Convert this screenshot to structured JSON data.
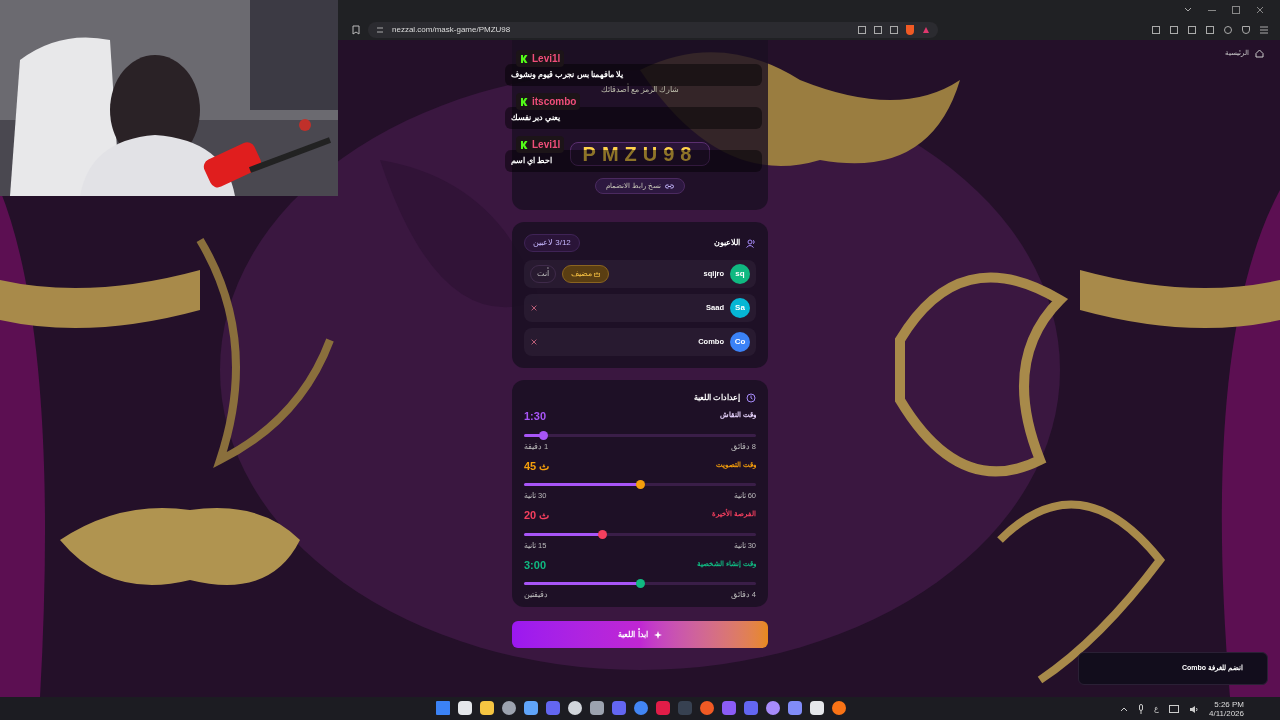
{
  "browser": {
    "url": "nezzal.com/mask-game/PMZU98"
  },
  "nav": {
    "home": "الرئيسية"
  },
  "room": {
    "share_hint": "شارك الرمز مع أصدقائك",
    "code": "PMZU98",
    "copy_link": "نسخ رابط الانضمام"
  },
  "chat_overlay": [
    {
      "user": "Levi1l",
      "message": "يلا مافهمنا بس نجرب قيوم ونشوف"
    },
    {
      "user": "itscombo",
      "message": "يعني دبر نفسك"
    },
    {
      "user": "Levi1l",
      "message": "احط اي اسم"
    }
  ],
  "players": {
    "title": "اللاعبون",
    "count": "3/12 لاعبين",
    "items": [
      {
        "name": "sqijro",
        "initials": "sq",
        "color": "#10b981",
        "host_badge": "مضيف",
        "you_tag": "أنت",
        "removable": false
      },
      {
        "name": "Saad",
        "initials": "Sa",
        "color": "#06b6d4",
        "removable": true
      },
      {
        "name": "Combo",
        "initials": "Co",
        "color": "#3b82f6",
        "removable": true
      }
    ]
  },
  "settings": {
    "title": "إعدادات اللعبة",
    "sliders": [
      {
        "label": "وقت النقاش",
        "value": "1:30",
        "color": "#a855f7",
        "level": 0.086,
        "max_label": "8 دقائق",
        "min_label": "1 دقيقة"
      },
      {
        "label": "وقت التصويت",
        "value": "45 ث",
        "color": "#f59e0b",
        "level": 0.5,
        "max_label": "60 ثانية",
        "min_label": "30 ثانية"
      },
      {
        "label": "الفرصة الأخيرة",
        "value": "20 ث",
        "color": "#f43f5e",
        "level": 0.34,
        "max_label": "30 ثانية",
        "min_label": "15 ثانية"
      },
      {
        "label": "وقت إنشاء الشخصية",
        "value": "3:00",
        "color": "#10b981",
        "level": 0.5,
        "max_label": "4 دقائق",
        "min_label": "دقيقتين"
      }
    ]
  },
  "start_button": "ابدأ اللعبة",
  "toast": "Combo انضم للغرفة",
  "taskbar": {
    "keyboard": "ع",
    "time": "5:26 PM",
    "date": "4/11/2026"
  }
}
